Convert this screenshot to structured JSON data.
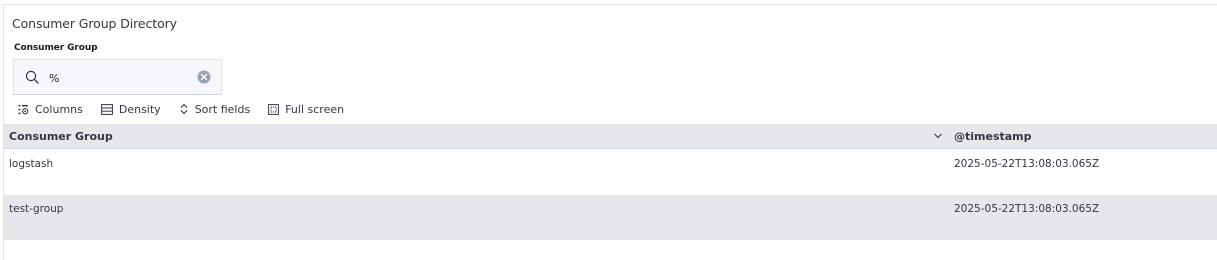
{
  "panel": {
    "title": "Consumer Group Directory"
  },
  "control": {
    "label": "Consumer Group",
    "search_value": "%",
    "icons": {
      "search": "search-icon",
      "clear": "clear-icon"
    }
  },
  "toolbar": {
    "columns_label": "Columns",
    "density_label": "Density",
    "sort_label": "Sort fields",
    "fullscreen_label": "Full screen",
    "icons": {
      "columns": "columns-icon",
      "density": "density-icon",
      "sort": "sort-icon",
      "fullscreen": "fullscreen-icon"
    }
  },
  "table": {
    "columns": [
      "Consumer Group",
      "@timestamp"
    ],
    "rows": [
      {
        "consumer_group": "logstash",
        "timestamp": "2025-05-22T13:08:03.065Z"
      },
      {
        "consumer_group": "test-group",
        "timestamp": "2025-05-22T13:08:03.065Z"
      }
    ]
  },
  "colors": {
    "header_bg": "#e6e7ea",
    "stripe_bg": "#e6e7ea",
    "text": "#343741",
    "input_bg": "#f5f7fa"
  }
}
